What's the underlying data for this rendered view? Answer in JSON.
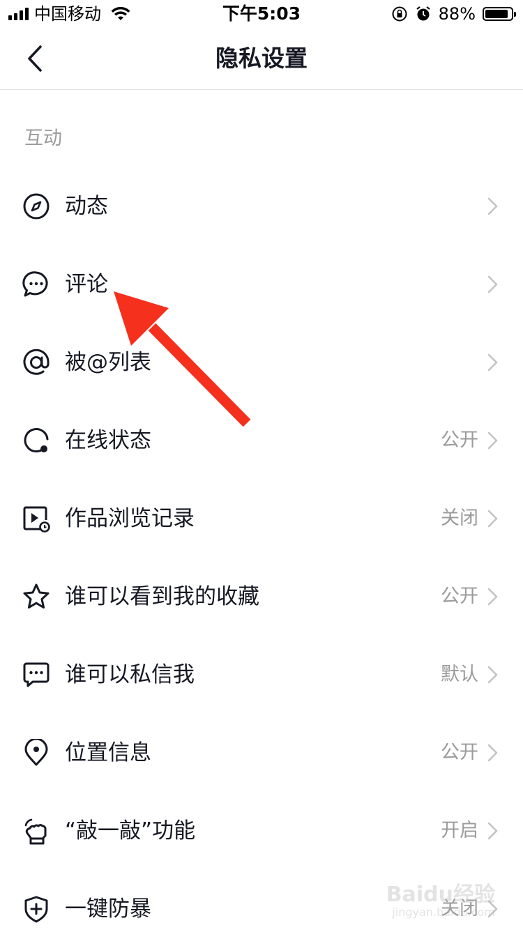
{
  "status_bar": {
    "carrier": "中国移动",
    "time": "下午5:03",
    "battery_percent": "88%",
    "battery_level": 0.88
  },
  "nav": {
    "title": "隐私设置",
    "back_icon": "chevron-left-icon"
  },
  "section": {
    "title": "互动"
  },
  "items": [
    {
      "label": "动态",
      "value": "",
      "icon": "compass-icon"
    },
    {
      "label": "评论",
      "value": "",
      "icon": "comment-bubble-icon"
    },
    {
      "label": "被@列表",
      "value": "",
      "icon": "at-icon"
    },
    {
      "label": "在线状态",
      "value": "公开",
      "icon": "online-status-icon"
    },
    {
      "label": "作品浏览记录",
      "value": "关闭",
      "icon": "video-history-icon"
    },
    {
      "label": "谁可以看到我的收藏",
      "value": "公开",
      "icon": "star-icon"
    },
    {
      "label": "谁可以私信我",
      "value": "默认",
      "icon": "message-icon"
    },
    {
      "label": "位置信息",
      "value": "公开",
      "icon": "location-pin-icon"
    },
    {
      "label": "“敲一敲”功能",
      "value": "开启",
      "icon": "knock-hand-icon"
    },
    {
      "label": "一键防暴",
      "value": "关闭",
      "icon": "shield-plus-icon"
    }
  ],
  "colors": {
    "text_primary": "#161823",
    "text_secondary": "#9b9b9b",
    "annotation_arrow": "#f5301d"
  },
  "watermark": {
    "main": "Baidu经验",
    "sub": "jingyan.baidu.com"
  }
}
